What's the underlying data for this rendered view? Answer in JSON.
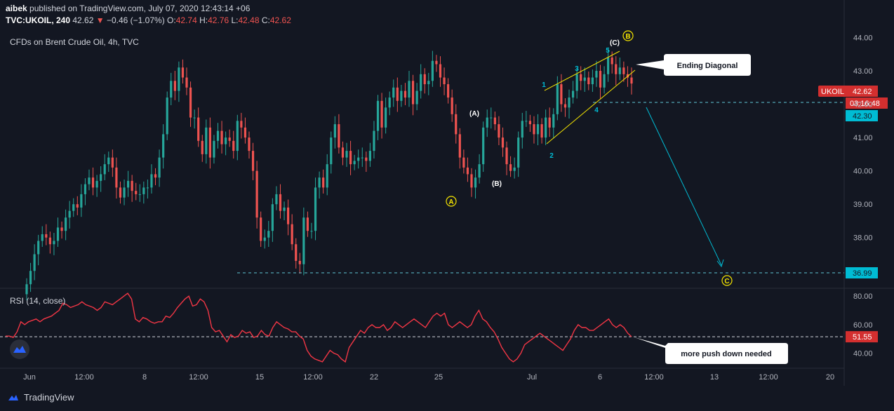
{
  "header": {
    "publisher": "aibek",
    "published_text": "published on TradingView.com, July 07, 2020 12:43:14 +06",
    "symbol": "TVC:UKOIL, 240",
    "last": "42.62",
    "change": "−0.46 (−1.07%)",
    "o_label": "O:",
    "o": "42.74",
    "h_label": "H:",
    "h": "42.76",
    "l_label": "L:",
    "l": "42.48",
    "c_label": "C:",
    "c": "42.62"
  },
  "chart_title": "CFDs on Brent Crude Oil, 4h, TVC",
  "rsi_title": "RSI (14, close)",
  "footer_brand": "TradingView",
  "colors": {
    "background": "#131722",
    "up": "#26a69a",
    "down": "#ef5350",
    "rsi_line": "#f23645",
    "wave_cyan": "#00bcd4",
    "channel": "#f5e500",
    "price_label": "#d32f2f"
  },
  "chart_data": [
    {
      "type": "candlestick",
      "title": "CFDs on Brent Crude Oil, 4h, TVC",
      "ylim": [
        36.5,
        44.2
      ],
      "y_ticks": [
        "44.00",
        "43.00",
        "42.00",
        "41.00",
        "40.00",
        "39.00",
        "38.00"
      ],
      "x_ticks": [
        "Jun",
        "12:00",
        "8",
        "12:00",
        "15",
        "12:00",
        "22",
        "25",
        "Jul",
        "6",
        "12:00",
        "13",
        "12:00",
        "20"
      ],
      "close": [
        36.6,
        37.0,
        37.5,
        37.9,
        38.1,
        38.0,
        37.8,
        37.9,
        38.3,
        38.2,
        38.6,
        38.8,
        39.0,
        38.9,
        39.3,
        39.6,
        39.8,
        39.5,
        39.7,
        39.9,
        40.2,
        40.4,
        40.1,
        39.5,
        39.2,
        39.5,
        39.7,
        39.4,
        39.3,
        39.3,
        39.5,
        39.5,
        39.9,
        39.8,
        40.4,
        41.1,
        42.2,
        42.7,
        42.4,
        43.1,
        42.8,
        42.5,
        41.6,
        41.6,
        40.9,
        40.5,
        41.3,
        40.4,
        40.9,
        41.2,
        40.8,
        41.0,
        40.9,
        40.6,
        41.5,
        41.3,
        41.0,
        40.6,
        40.0,
        38.6,
        37.9,
        38.0,
        38.2,
        39.0,
        39.3,
        38.8,
        38.9,
        38.4,
        37.8,
        37.3,
        37.2,
        38.6,
        38.2,
        38.2,
        39.5,
        39.8,
        39.5,
        40.2,
        41.0,
        41.4,
        40.7,
        40.4,
        40.6,
        40.2,
        40.3,
        40.4,
        40.4,
        40.3,
        40.6,
        41.2,
        42.1,
        41.3,
        41.9,
        42.2,
        42.5,
        42.1,
        42.4,
        42.2,
        42.7,
        42.0,
        42.4,
        42.9,
        42.6,
        42.7,
        43.3,
        43.2,
        42.8,
        42.6,
        42.2,
        41.7,
        41.1,
        40.4,
        40.1,
        39.9,
        39.5,
        39.8,
        40.2,
        41.3,
        41.6,
        41.6,
        41.4,
        41.0,
        40.7,
        40.2,
        40.0,
        40.1,
        41.0,
        41.5,
        41.5,
        41.4,
        41.1,
        41.4,
        41.0,
        41.6,
        41.3,
        41.7,
        42.6,
        42.0,
        41.9,
        42.2,
        42.4,
        42.9,
        42.7,
        42.8,
        42.6,
        42.8,
        43.0,
        42.5,
        42.9,
        43.4,
        43.2,
        42.9,
        43.1,
        42.9,
        42.8,
        42.62
      ],
      "wave_labels": [
        "1",
        "2",
        "3",
        "4",
        "5",
        "(A)",
        "(B)",
        "(C)",
        "A",
        "B",
        "C"
      ],
      "annotations": [
        "Ending Diagonal",
        "more push down needed"
      ],
      "price_labels": {
        "symbol": "UKOIL",
        "last": "42.62",
        "countdown": "03:16:48",
        "level_upper": "42.30",
        "level_lower": "36.99"
      }
    },
    {
      "type": "line",
      "title": "RSI (14, close)",
      "ylim": [
        30,
        85
      ],
      "y_ticks": [
        "80.00",
        "60.00",
        "40.00"
      ],
      "dashed_level": 51.55,
      "last_label": "51.55",
      "values": [
        52,
        52,
        51,
        55,
        62,
        60,
        62,
        63,
        64,
        62,
        64,
        65,
        66,
        68,
        70,
        75,
        74,
        72,
        73,
        74,
        76,
        74,
        73,
        72,
        70,
        72,
        76,
        75,
        74,
        76,
        78,
        80,
        82,
        78,
        64,
        62,
        65,
        64,
        62,
        61,
        62,
        62,
        66,
        65,
        68,
        72,
        75,
        78,
        80,
        73,
        74,
        78,
        76,
        70,
        58,
        55,
        56,
        52,
        48,
        53,
        51,
        52,
        56,
        54,
        55,
        51,
        52,
        56,
        53,
        52,
        58,
        62,
        60,
        58,
        57,
        55,
        55,
        52,
        50,
        42,
        38,
        36,
        35,
        34,
        38,
        42,
        40,
        39,
        36,
        34,
        44,
        48,
        52,
        56,
        54,
        58,
        60,
        58,
        58,
        60,
        56,
        58,
        62,
        60,
        58,
        60,
        62,
        64,
        62,
        60,
        58,
        62,
        66,
        68,
        66,
        68,
        60,
        58,
        60,
        62,
        60,
        58,
        60,
        66,
        70,
        64,
        62,
        58,
        55,
        50,
        44,
        40,
        36,
        34,
        36,
        40,
        46,
        48,
        50,
        52,
        54,
        52,
        50,
        48,
        46,
        44,
        42,
        46,
        50,
        56,
        60,
        58,
        58,
        56,
        56,
        58,
        60,
        62,
        64,
        60,
        58,
        60,
        58,
        54,
        51.55
      ]
    }
  ]
}
